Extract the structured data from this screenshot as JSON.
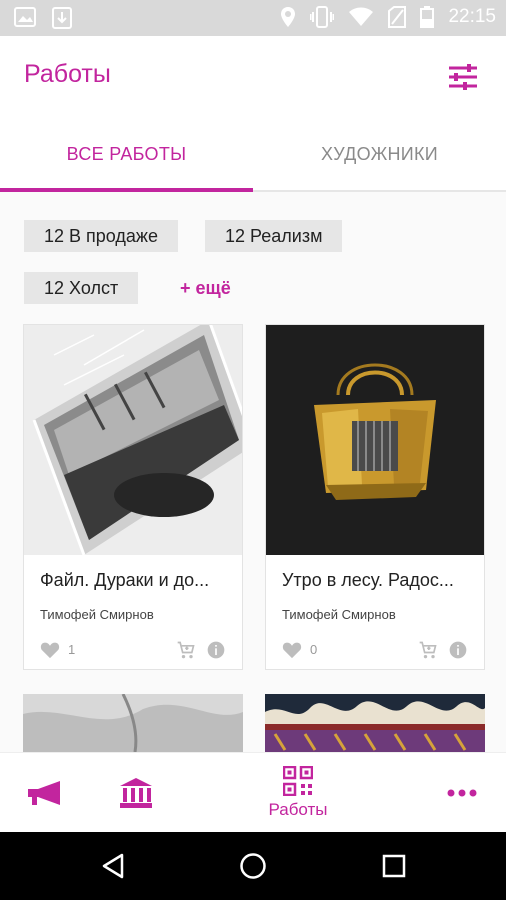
{
  "status_bar": {
    "time": "22:15"
  },
  "header": {
    "title": "Работы"
  },
  "tabs": [
    {
      "label": "ВСЕ РАБОТЫ"
    },
    {
      "label": "ХУДОЖНИКИ"
    }
  ],
  "filters": {
    "chips": [
      {
        "label": "12 В продаже"
      },
      {
        "label": "12 Реализм"
      },
      {
        "label": "12 Холст"
      }
    ],
    "more_label": "+ ещё"
  },
  "cards": [
    {
      "title": "Файл. Дураки и до...",
      "artist": "Тимофей Смирнов",
      "likes": "1"
    },
    {
      "title": "Утро в лесу. Радос...",
      "artist": "Тимофей Смирнов",
      "likes": "0"
    }
  ],
  "bottom_nav": {
    "works_label": "Работы"
  },
  "colors": {
    "accent": "#c2259e",
    "chip_bg": "#e6e6e6",
    "status_bar": "#d9d9d9"
  },
  "icons": [
    "image-icon",
    "download-icon",
    "location-icon",
    "vibrate-icon",
    "wifi-icon",
    "no-sim-icon",
    "battery-icon",
    "filter-icon",
    "heart-icon",
    "cart-icon",
    "info-icon",
    "megaphone-icon",
    "museum-icon",
    "qr-icon",
    "more-icon",
    "back-icon",
    "home-icon",
    "recents-icon"
  ]
}
